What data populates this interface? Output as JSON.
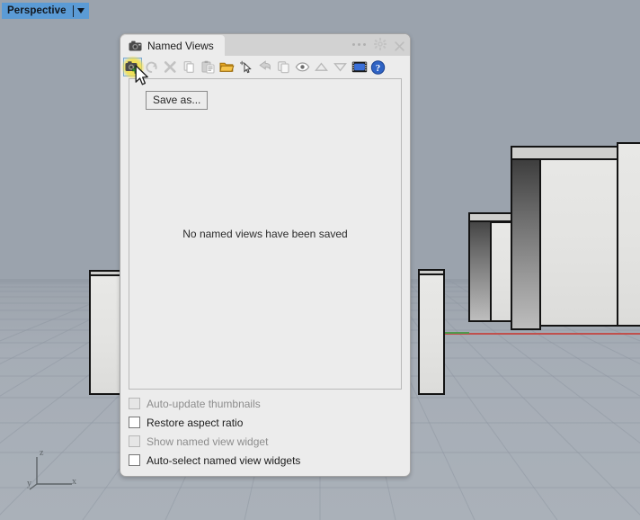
{
  "viewport": {
    "title": "Perspective",
    "dropdown_icon": "chevron-down-icon",
    "axis_gizmo": {
      "x": "x",
      "y": "y",
      "z": "z"
    }
  },
  "panel": {
    "tab": {
      "icon": "camera-icon",
      "title": "Named Views"
    },
    "header_controls": [
      {
        "name": "overflow-dots",
        "icon": "ellipsis-icon"
      },
      {
        "name": "panel-options",
        "icon": "gear-icon"
      },
      {
        "name": "panel-close",
        "icon": "close-icon"
      }
    ],
    "toolbar": [
      {
        "name": "save-as",
        "icon": "camera-plus-icon",
        "label": "Save as...",
        "state": "active"
      },
      {
        "name": "restore",
        "icon": "restore-arrow-icon",
        "state": "disabled"
      },
      {
        "name": "delete",
        "icon": "delete-x-icon",
        "state": "disabled"
      },
      {
        "name": "copy",
        "icon": "copy-icon",
        "state": "disabled"
      },
      {
        "name": "paste",
        "icon": "paste-icon",
        "state": "disabled"
      },
      {
        "name": "open-folder",
        "icon": "folder-open-icon",
        "state": "enabled"
      },
      {
        "name": "set-view",
        "icon": "cursor-move-icon",
        "state": "enabled"
      },
      {
        "name": "rename",
        "icon": "rename-arrow-icon",
        "state": "disabled"
      },
      {
        "name": "duplicate",
        "icon": "duplicate-icon",
        "state": "disabled"
      },
      {
        "name": "visibility",
        "icon": "eye-icon",
        "state": "disabled"
      },
      {
        "name": "move-up",
        "icon": "triangle-up-icon",
        "state": "disabled"
      },
      {
        "name": "move-down",
        "icon": "triangle-down-icon",
        "state": "disabled"
      },
      {
        "name": "animate",
        "icon": "filmstrip-icon",
        "state": "enabled"
      },
      {
        "name": "help",
        "icon": "help-icon",
        "state": "enabled"
      }
    ],
    "tooltip": "Save as...",
    "list": {
      "empty_message": "No named views have been saved"
    },
    "options": [
      {
        "label": "Auto-update thumbnails",
        "checked": false,
        "disabled": true
      },
      {
        "label": "Restore aspect ratio",
        "checked": false,
        "disabled": false
      },
      {
        "label": "Show named view widget",
        "checked": false,
        "disabled": true
      },
      {
        "label": "Auto-select named view widgets",
        "checked": false,
        "disabled": false
      }
    ]
  },
  "colors": {
    "viewport_title_bg": "#5b9bd5",
    "sky": "#9ba3ad",
    "ground": "#a6adb6",
    "panel_bg": "#ececec",
    "axis_red": "#c0504d",
    "axis_green": "#4e9a4e",
    "highlight_yellow": "#f7e03c"
  }
}
